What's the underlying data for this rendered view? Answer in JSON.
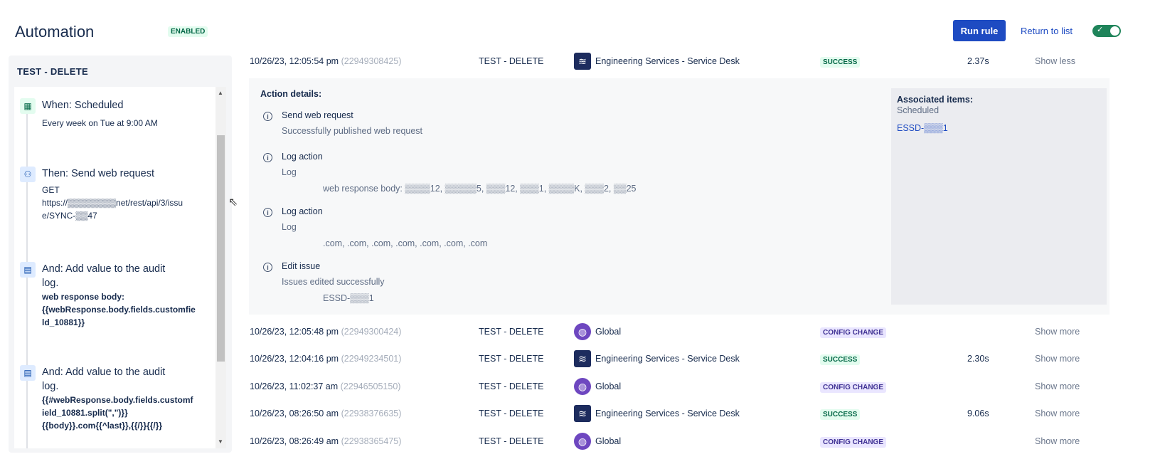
{
  "header": {
    "title": "Automation",
    "status_badge": "ENABLED",
    "run_rule": "Run rule",
    "return_to_list": "Return to list",
    "toggle_on": true
  },
  "sidebar": {
    "rule_name": "TEST - DELETE",
    "steps": [
      {
        "heading": "When: Scheduled",
        "lines": [
          "Every week on Tue at 9:00 AM"
        ],
        "icon": "calendar-icon"
      },
      {
        "heading": "Then: Send web request",
        "lines": [
          "GET",
          "https://▒▒▒▒▒▒▒▒net/rest/api/3/issu",
          "e/SYNC-▒▒47"
        ],
        "icon": "webhook-icon"
      },
      {
        "heading": "And: Add value to the audit",
        "heading2": "log.",
        "bold": [
          "web response body:",
          "{{webResponse.body.fields.customfie",
          "ld_10881}}"
        ],
        "icon": "log-icon"
      },
      {
        "heading": "And: Add value to the audit",
        "heading2": "log.",
        "bold": [
          "{{#webResponse.body.fields.customf",
          "ield_10881.split(\",\")}}",
          "{{body}}.com{{^last}},{{/}}{{/}}"
        ],
        "icon": "log-icon"
      }
    ]
  },
  "expanded": {
    "date": "10/26/23, 12:05:54 pm",
    "id": "(22949308425)",
    "rule": "TEST - DELETE",
    "project": "Engineering Services - Service Desk",
    "status": "SUCCESS",
    "duration": "2.37s",
    "toggle": "Show less"
  },
  "details": {
    "title": "Action details:",
    "actions": [
      {
        "name": "Send web request",
        "desc": "Successfully published web request"
      },
      {
        "name": "Log action",
        "desc": "Log",
        "extra": "web response body: ▒▒▒▒12, ▒▒▒▒▒5, ▒▒▒12, ▒▒▒1, ▒▒▒▒K, ▒▒▒2, ▒▒25"
      },
      {
        "name": "Log action",
        "desc": "Log",
        "extra": ".com, .com, .com, .com, .com, .com, .com"
      },
      {
        "name": "Edit issue",
        "desc": "Issues edited successfully",
        "extra": "ESSD-▒▒▒1"
      }
    ],
    "associated": {
      "title": "Associated items:",
      "trigger": "Scheduled",
      "item": "ESSD-▒▒▒1"
    }
  },
  "rows": [
    {
      "date": "10/26/23, 12:05:48 pm",
      "id": "(22949300424)",
      "rule": "TEST - DELETE",
      "project": "Global",
      "ptype": "global",
      "status": "CONFIG CHANGE",
      "duration": "",
      "toggle": "Show more"
    },
    {
      "date": "10/26/23, 12:04:16 pm",
      "id": "(22949234501)",
      "rule": "TEST - DELETE",
      "project": "Engineering Services - Service Desk",
      "ptype": "eng",
      "status": "SUCCESS",
      "duration": "2.30s",
      "toggle": "Show more"
    },
    {
      "date": "10/26/23, 11:02:37 am",
      "id": "(22946505150)",
      "rule": "TEST - DELETE",
      "project": "Global",
      "ptype": "global",
      "status": "CONFIG CHANGE",
      "duration": "",
      "toggle": "Show more"
    },
    {
      "date": "10/26/23, 08:26:50 am",
      "id": "(22938376635)",
      "rule": "TEST - DELETE",
      "project": "Engineering Services - Service Desk",
      "ptype": "eng",
      "status": "SUCCESS",
      "duration": "9.06s",
      "toggle": "Show more"
    },
    {
      "date": "10/26/23, 08:26:49 am",
      "id": "(22938365475)",
      "rule": "TEST - DELETE",
      "project": "Global",
      "ptype": "global",
      "status": "CONFIG CHANGE",
      "duration": "",
      "toggle": "Show more"
    }
  ]
}
